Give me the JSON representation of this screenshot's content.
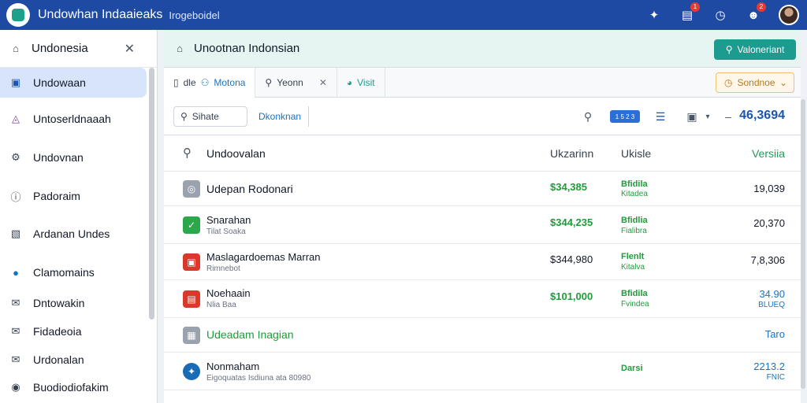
{
  "app": {
    "title": "Undowhan Indaaieaks",
    "subtitle": "Irogeboidel",
    "notifications_badge": "1",
    "profile_badge": "2"
  },
  "sidebar": {
    "header": "Undonesia",
    "items": [
      {
        "label": "Undowaan",
        "icon": "doc-icon"
      },
      {
        "label": "Untoserldnaaah",
        "icon": "chart-icon"
      },
      {
        "label": "Undovnan",
        "icon": "gear-icon"
      },
      {
        "label": "Padoraim",
        "icon": "info-icon"
      },
      {
        "label": "Ardanan Undes",
        "icon": "chart-icon"
      },
      {
        "label": "Clamomains",
        "icon": "circle-icon"
      },
      {
        "label": "Dntowakin",
        "icon": "mail-icon"
      },
      {
        "label": "Fidadeoia",
        "icon": "mail-icon"
      },
      {
        "label": "Urdonalan",
        "icon": "mail-icon"
      },
      {
        "label": "Buodiodiofakim",
        "icon": "circle-icon"
      }
    ]
  },
  "main": {
    "title": "Unootnan Indonsian",
    "primary_button": "Valoneriant",
    "tabs": [
      {
        "label_a": "dle",
        "label_b": "Motona"
      },
      {
        "label": "Yeonn"
      },
      {
        "label": "Visit"
      }
    ],
    "sort_label": "Sondnoe",
    "search_label": "Sihate",
    "filter_label": "Dkonknan",
    "pill_label": "1 5 2 3",
    "total": "46,3694",
    "columns": [
      "Undoovalan",
      "Ukzarinn",
      "Ukisle",
      "Versiia"
    ],
    "rows": [
      {
        "name": "Udepan Rodonari",
        "sub": "",
        "amount": "$34,385",
        "status": "Bfidila",
        "status2": "Kitadea",
        "value": "19,039",
        "value2": "",
        "icon": "clock-icon",
        "icon_color": "#9aa3ad"
      },
      {
        "name": "Snarahan",
        "sub": "Tilat Soaka",
        "amount": "$344,235",
        "status": "Bfidlia",
        "status2": "Fialibra",
        "value": "20,370",
        "value2": "",
        "icon": "check-icon",
        "icon_color": "#2aa84a"
      },
      {
        "name": "Maslagardoemas Marran",
        "sub": "Rimnebot",
        "amount": "$344,980",
        "status": "Flenlt",
        "status2": "Kitalva",
        "value": "7,8,306",
        "value2": "",
        "icon": "box-icon",
        "icon_color": "#d8392b"
      },
      {
        "name": "Noehaain",
        "sub": "Nlia Baa",
        "amount": "$101,000",
        "status": "Bfidila",
        "status2": "Fvindea",
        "value": "34.90",
        "value2": "BLUEQ",
        "icon": "doc-icon",
        "icon_color": "#d8392b"
      },
      {
        "name": "Udeadam Inagian",
        "sub": "",
        "amount": "",
        "status": "",
        "status2": "",
        "value": "Taro",
        "value2": "",
        "icon": "image-icon",
        "icon_color": "#9aa3ad"
      },
      {
        "name": "Nonmaham",
        "sub": "Eigoquatas Isdiuna ata 80980",
        "amount": "",
        "status": "Darsi",
        "status2": "",
        "value": "2213.2",
        "value2": "FNIC",
        "icon": "compass-icon",
        "icon_color": "#1a6bb5"
      }
    ]
  }
}
